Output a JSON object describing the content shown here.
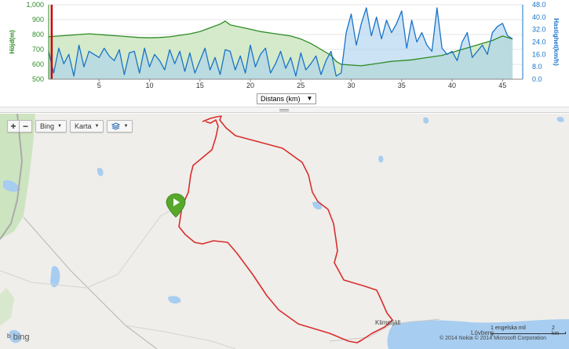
{
  "chart_data": {
    "type": "area",
    "xlabel": "Distans (km)",
    "ylabel_left": "Höjd(m)",
    "ylabel_right": "Hastighet(km/h)",
    "xlim": [
      0,
      47
    ],
    "ylim_left": [
      500,
      1000
    ],
    "ylim_right": [
      0,
      48
    ],
    "x_ticks": [
      "5",
      "10",
      "15",
      "20",
      "25",
      "30",
      "35",
      "40",
      "45"
    ],
    "y_left_ticks": [
      "1,000",
      "900",
      "800",
      "700",
      "600",
      "500"
    ],
    "y_right_ticks": [
      "48.0",
      "40.0",
      "32.0",
      "24.0",
      "16.0",
      "8.0",
      "0.0"
    ],
    "colors": {
      "elevation": "#2e8b25",
      "elevation_fill": "#cfe8c4",
      "speed": "#1a73c8",
      "speed_fill": "#a9d0ee",
      "marker": "#cc0000",
      "left_axis": "#2e8b25",
      "right_axis": "#1a73c8"
    },
    "marker_x": 0.3,
    "series": [
      {
        "key": "elevation",
        "x": [
          0,
          1,
          2,
          3,
          4,
          5,
          6,
          7,
          8,
          9,
          10,
          11,
          12,
          13,
          14,
          15,
          16,
          17,
          17.5,
          18,
          19,
          20,
          21,
          22,
          23,
          24,
          25,
          26,
          27,
          28,
          28.5,
          29,
          30,
          31,
          32,
          33,
          34,
          35,
          36,
          37,
          38,
          39,
          40,
          41,
          42,
          43,
          44,
          45,
          46
        ],
        "values": [
          785,
          790,
          795,
          800,
          805,
          800,
          795,
          790,
          785,
          780,
          778,
          780,
          785,
          795,
          805,
          820,
          845,
          870,
          890,
          865,
          850,
          835,
          820,
          810,
          800,
          790,
          770,
          740,
          700,
          660,
          620,
          600,
          595,
          590,
          600,
          610,
          620,
          625,
          630,
          640,
          650,
          660,
          680,
          700,
          720,
          740,
          760,
          790,
          770
        ]
      },
      {
        "key": "speed",
        "x": [
          0,
          0.5,
          1,
          1.5,
          2,
          2.5,
          3,
          3.5,
          4,
          4.5,
          5,
          5.5,
          6,
          6.5,
          7,
          7.5,
          8,
          8.5,
          9,
          9.5,
          10,
          10.5,
          11,
          11.5,
          12,
          12.5,
          13,
          13.5,
          14,
          14.5,
          15,
          15.5,
          16,
          16.5,
          17,
          17.5,
          18,
          18.5,
          19,
          19.5,
          20,
          20.5,
          21,
          21.5,
          22,
          22.5,
          23,
          23.5,
          24,
          24.5,
          25,
          25.5,
          26,
          26.5,
          27,
          27.5,
          28,
          28.5,
          29,
          29.5,
          30,
          30.5,
          31,
          31.5,
          32,
          32.5,
          33,
          33.5,
          34,
          34.5,
          35,
          35.5,
          36,
          36.5,
          37,
          37.5,
          38,
          38.5,
          39,
          39.5,
          40,
          40.5,
          41,
          41.5,
          42,
          42.5,
          43,
          43.5,
          44,
          44.5,
          45,
          45.5,
          46
        ],
        "values": [
          18,
          4,
          20,
          10,
          16,
          2,
          22,
          8,
          18,
          16,
          14,
          20,
          15,
          12,
          19,
          3,
          17,
          18,
          4,
          20,
          8,
          16,
          12,
          6,
          19,
          10,
          18,
          5,
          17,
          4,
          12,
          20,
          6,
          14,
          3,
          19,
          18,
          6,
          15,
          4,
          22,
          8,
          16,
          20,
          4,
          10,
          18,
          7,
          14,
          2,
          17,
          6,
          10,
          15,
          3,
          12,
          18,
          2,
          4,
          30,
          42,
          22,
          36,
          46,
          28,
          40,
          26,
          38,
          30,
          36,
          44,
          20,
          38,
          24,
          30,
          22,
          18,
          46,
          20,
          16,
          18,
          12,
          24,
          30,
          14,
          18,
          22,
          16,
          30,
          34,
          36,
          28,
          26
        ]
      }
    ]
  },
  "map": {
    "zoom_in": "+",
    "zoom_out": "−",
    "provider_button": "Bing",
    "type_button": "Karta",
    "layers_icon": "layers-icon",
    "place_labels": [
      "Klimpfjäll",
      "Lövberg"
    ],
    "scale_mile": "1 engelska mil",
    "scale_km": "2 km",
    "copyright": "© 2014 Nokia   © 2014 Microsoft Corporation",
    "logo": "bing",
    "route_color": "#d92e2e",
    "start_marker_color": "#58a82c"
  }
}
